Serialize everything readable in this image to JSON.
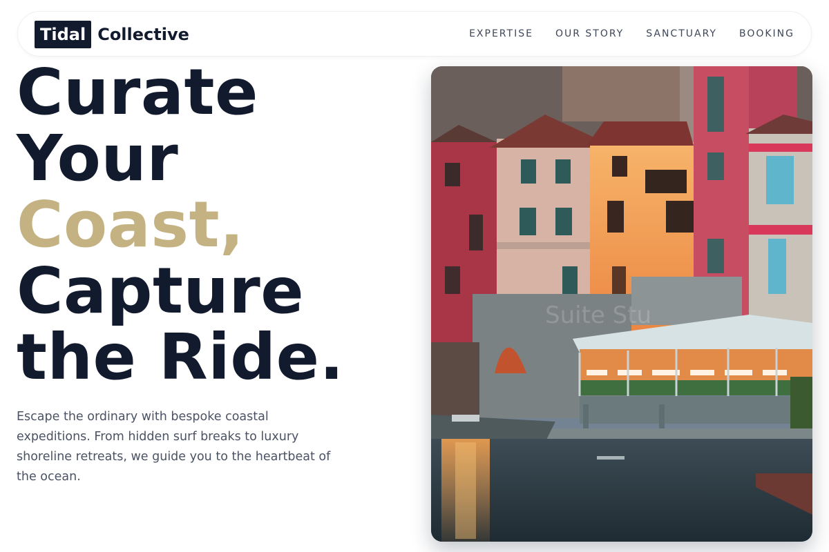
{
  "brand": {
    "mark": "Tidal",
    "word": "Collective"
  },
  "nav": {
    "items": [
      {
        "label": "EXPERTISE"
      },
      {
        "label": "OUR STORY"
      },
      {
        "label": "SANCTUARY"
      },
      {
        "label": "BOOKING"
      }
    ]
  },
  "hero": {
    "lines": [
      "Curate",
      "Your",
      "Coast,",
      "Capture",
      "the Ride."
    ],
    "tagline": "Escape the ordinary with bespoke coastal expeditions. From hidden surf breaks to luxury shoreline retreats, we guide you to the heartbeat of the ocean."
  },
  "photo": {
    "watermark": "Suite Stu"
  },
  "colors": {
    "navy": "#121a2e",
    "accent": "#c4b283",
    "muted": "#4a5264"
  }
}
